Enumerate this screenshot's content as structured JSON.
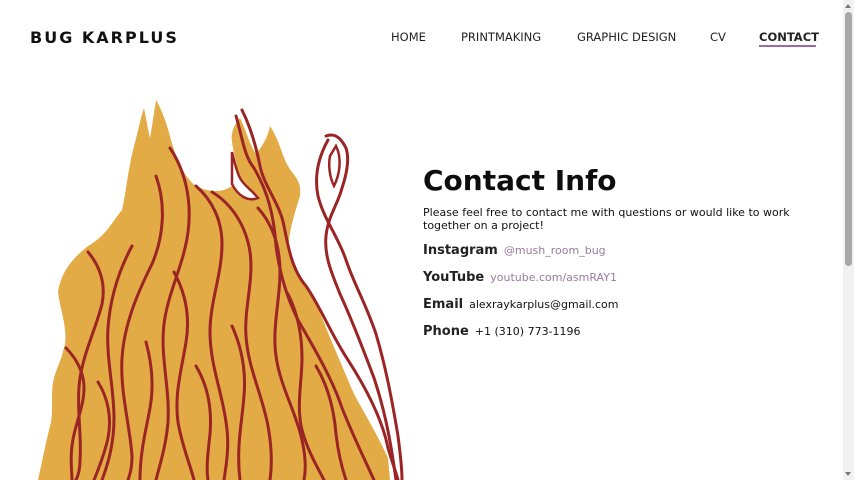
{
  "header": {
    "brand": "BUG KARPLUS",
    "nav": [
      {
        "label": "HOME"
      },
      {
        "label": "PRINTMAKING"
      },
      {
        "label": "GRAPHIC DESIGN"
      },
      {
        "label": "CV"
      },
      {
        "label": "CONTACT",
        "active": true
      }
    ]
  },
  "contact": {
    "title": "Contact Info",
    "intro": "Please feel free to contact me with questions or would like to work together on a project!",
    "items": [
      {
        "label": "Instagram",
        "value": "@mush_room_bug"
      },
      {
        "label": "YouTube",
        "value": "youtube.com/asmRAY1"
      },
      {
        "label": "Email",
        "value": "alexraykarplus@gmail.com"
      },
      {
        "label": "Phone",
        "value": "+1 (310) 773-1196"
      }
    ]
  },
  "colors": {
    "flame_fill": "#e2ab45",
    "flame_stroke": "#9b2424",
    "nav_underline": "#9c6aa0",
    "link": "#9a7aa0"
  }
}
